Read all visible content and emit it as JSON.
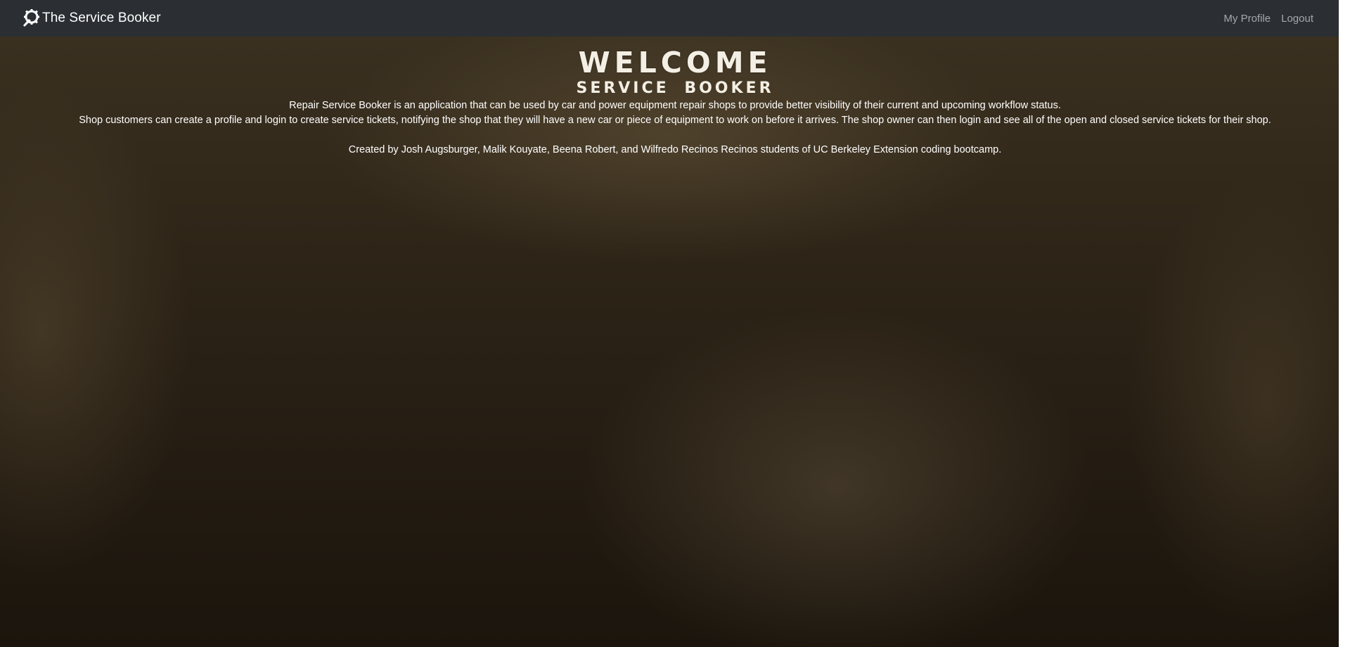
{
  "navbar": {
    "brand_label": "The Service Booker",
    "brand_icon": "wrench-gear-icon",
    "links": [
      {
        "label": "My Profile"
      },
      {
        "label": "Logout"
      }
    ]
  },
  "hero": {
    "title": "WELCOME",
    "subtitle": "SERVICE BOOKER",
    "description_line_1": "Repair Service Booker is an application that can be used by car and power equipment repair shops to provide better visibility of their current and upcoming workflow status.",
    "description_line_2": "Shop customers can create a profile and login to create service tickets, notifying the shop that they will have a new car or piece of equipment to work on before it arrives. The shop owner can then login and see all of the open and closed service tickets for their shop.",
    "credits": "Created by Josh Augsburger, Malik Kouyate, Beena Robert, and Wilfredo Recinos Recinos students of UC Berkeley Extension coding bootcamp."
  },
  "colors": {
    "navbar_bg": "#2b2f33",
    "nav_link": "#a5a8ab",
    "hero_text": "#ffffff"
  }
}
